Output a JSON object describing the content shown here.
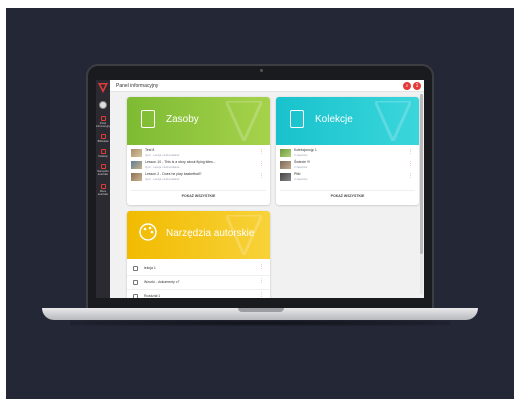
{
  "app": {
    "title": "Panel informacyjny"
  },
  "topbar": {
    "search_icon": "search-icon",
    "user_badge": "1"
  },
  "sidebar": {
    "items": [
      {
        "label": "Panel informacyjny",
        "icon": "home-icon"
      },
      {
        "label": "Biblioteka",
        "icon": "library-icon"
      },
      {
        "label": "Kolekcje",
        "icon": "collection-icon"
      },
      {
        "label": "Narzędzia autorskie",
        "icon": "tools-icon"
      },
      {
        "label": "Menu autorskie",
        "icon": "menu-icon"
      }
    ]
  },
  "zasoby": {
    "title": "Zasoby",
    "color": "#8cc63f",
    "items": [
      {
        "title": "Test 8",
        "sub": "Quiz  ·  Lekcja multimedialna"
      },
      {
        "title": "Lesson 10 - This is a story about flying kites...",
        "sub": "Quiz  ·  Lekcja multimedialna"
      },
      {
        "title": "Lesson 2 - Does he play basketball?",
        "sub": "Quiz  ·  Lekcja multimedialna"
      }
    ],
    "more": "POKAŻ WSZYSTKIE"
  },
  "kolekcje": {
    "title": "Kolekcje",
    "color": "#1ec6d2",
    "items": [
      {
        "title": "Kolekcjonuję 1",
        "sub": "0 zasobów"
      },
      {
        "title": "Świecie !!!",
        "sub": "3 zasobów"
      },
      {
        "title": "Pliki",
        "sub": "4 zasobów"
      }
    ],
    "more": "POKAŻ WSZYSTKIE"
  },
  "narzedzia": {
    "title": "Narzędzia autorskie",
    "color": "#f3c300",
    "items": [
      {
        "label": "lekcja 1"
      },
      {
        "label": "Wzorki - dokumenty v7"
      },
      {
        "label": "Rozdział 1"
      }
    ]
  }
}
